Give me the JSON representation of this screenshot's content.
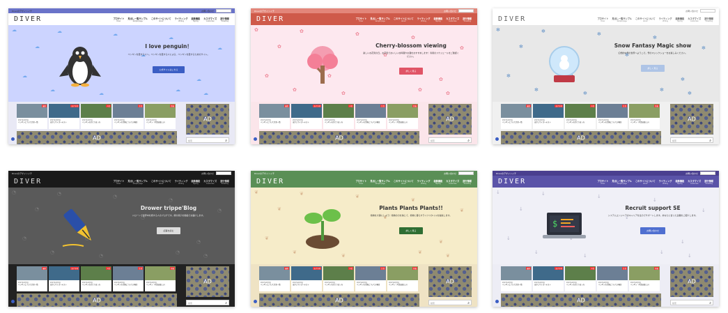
{
  "cards": [
    {
      "tagline": "Diverのデザインイチ",
      "top_link": "お問い合わせ",
      "logo": "DIVER",
      "title": "I love penguin！",
      "desc": "ペンギンを愛する人へ。ペンギンを愛する人による、ペンギンを愛するためのサイト。",
      "button": "公式サイトはこちら",
      "colors": {
        "top": "#6a73c9",
        "hdr": "#ffffff",
        "hdrtext": "#333333",
        "hero": "#ccd4ff",
        "btn": "#3b5ec4",
        "content": "#e9e9f5",
        "deco": "#74a9ef"
      },
      "deco": "☁",
      "icon": "penguin-icon"
    },
    {
      "tagline": "Diverのデザインイチ",
      "top_link": "お問い合わせ",
      "logo": "DIVER",
      "title": "Cherry-blossom viewing",
      "desc": "楽しいお花見の日。お花見でおいしいお料理やお酒をおすすめします！専用のスケジュールをご確認ください。",
      "button": "詳しく見る",
      "colors": {
        "top": "#e3867a",
        "hdr": "#cf5a4a",
        "hdrtext": "#ffffff",
        "hero": "#fde8ef",
        "btn": "#e05466",
        "content": "#fbe5ea",
        "deco": "#ee8899"
      },
      "deco": "✿",
      "icon": "cherry-tree-icon"
    },
    {
      "tagline": "",
      "top_link": "お問い合わせ",
      "logo": "DIVER",
      "title": "Snow Fantasy Magic show",
      "desc": "幻想的な雪の世界へようこそ。雪のマジックショーをお楽しみください。",
      "button": "詳しく見る",
      "colors": {
        "top": "#ffffff",
        "hdr": "#ffffff",
        "hdrtext": "#666666",
        "hero": "#e8e8e8",
        "btn": "#aec4e6",
        "content": "#f0f0f0",
        "deco": "#6a96c8"
      },
      "deco": "✻",
      "icon": "snow-globe-icon"
    },
    {
      "tagline": "Diverのデザインイチ",
      "top_link": "お問い合わせ",
      "logo": "DIVER",
      "title": "Drower trippe'Blog",
      "desc": "ドローンで世界中を旅する人のブログです。旅の様子を動画でお届けします。",
      "button": "記事を読む",
      "colors": {
        "top": "#1a1a1a",
        "hdr": "#1a1a1a",
        "hdrtext": "#dddddd",
        "hero": "#5a5a5a",
        "btn": "#dddddd",
        "content": "#222222",
        "deco": "#777777"
      },
      "deco": "◔",
      "icon": "fountain-pen-icon"
    },
    {
      "tagline": "Diverのデザインイチ",
      "top_link": "お問い合わせ",
      "logo": "DIVER",
      "title": "Plants Plants Plants!!",
      "desc": "植物を大事にしよう！植物の力を信じて、植物と暮らすライフスタイルを提案します。",
      "button": "詳しく見る",
      "colors": {
        "top": "#5a8f56",
        "hdr": "#5a8f56",
        "hdrtext": "#ffffff",
        "hero": "#f6ecc9",
        "btn": "#2f6e33",
        "content": "#efe3c4",
        "deco": "#d9b690"
      },
      "deco": "❦",
      "icon": "sprout-icon"
    },
    {
      "tagline": "Diverのデザインイチ",
      "top_link": "お問い合わせ",
      "logo": "DIVER",
      "title": "Recruit support SE",
      "desc": "システムエンジニアのキャリアを全力でサポートします。あなたに合った企業をご紹介します。",
      "button": "お問い合わせ",
      "colors": {
        "top": "#4a3f8f",
        "hdr": "#5a53a8",
        "hdrtext": "#ffffff",
        "hero": "#f0f0f7",
        "btn": "#4f6fd0",
        "content": "#ededf5",
        "deco": "#b5b5c9"
      },
      "deco": "↓",
      "icon": "laptop-code-icon"
    }
  ],
  "nav": [
    {
      "jp": "プロサイト",
      "en": "Diver"
    },
    {
      "jp": "見出し一覧サンプル",
      "en": "sample page"
    },
    {
      "jp": "このサイトについて",
      "en": "About"
    },
    {
      "jp": "ライティング",
      "en": "Writing"
    },
    {
      "jp": "装飾機能",
      "en": "Styling"
    },
    {
      "jp": "カスタマイズ",
      "en": "Customize"
    },
    {
      "jp": "旅行情報",
      "en": "Travelling"
    }
  ],
  "posts": [
    {
      "label": "最新",
      "date": "2017年2月8日",
      "title": "ペンギンについて完全一覧"
    },
    {
      "label": "おすすめ",
      "date": "2017年2月8日",
      "title": "ぼかしサイズーテスト"
    },
    {
      "label": "人気",
      "date": "2017年2月8日",
      "title": "ペンギンのひとりぼっち"
    },
    {
      "label": "注目",
      "date": "2017年2月8日",
      "title": "ペンギンの生態についての報告"
    },
    {
      "label": "新着",
      "date": "2017年2月8日",
      "title": "ペンギン（写真は楽しい）"
    }
  ],
  "ad_label": "AD",
  "search_placeholder": "検索"
}
